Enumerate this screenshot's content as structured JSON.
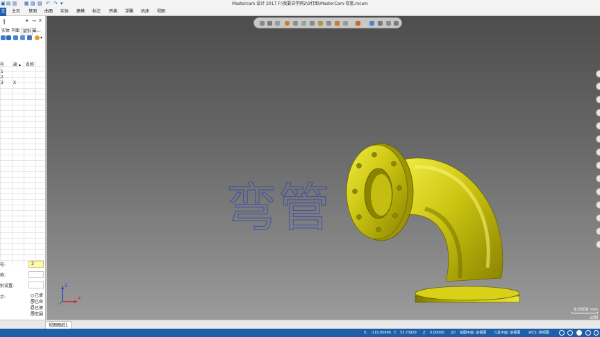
{
  "window": {
    "title": "Mastercam 设计 2017  F:\\我要自学网2\\9打图\\MasterCam-弯管.mcam"
  },
  "ribbon": {
    "file_tab": "文",
    "tabs": [
      "主页",
      "草图",
      "曲面",
      "实体",
      "建模",
      "标注",
      "转换",
      "浮雕",
      "机床",
      "视图"
    ]
  },
  "left_panel": {
    "title": "刂",
    "tabs": [
      "实体",
      "平面",
      "层别",
      "最..."
    ],
    "columns": [
      "号",
      "高",
      "名称"
    ],
    "rows": [
      {
        "num": "1",
        "flag": ""
      },
      {
        "num": "2",
        "flag": ""
      },
      {
        "num": "3",
        "flag": "X"
      }
    ],
    "fields": [
      {
        "label": "号:",
        "value": "3"
      },
      {
        "label": "称:",
        "value": ""
      },
      {
        "label": "别设置:",
        "value": ""
      }
    ],
    "display_label": "示:",
    "radio_options": [
      "已使用",
      "已命名",
      "已使用",
      "范围"
    ]
  },
  "viewport": {
    "model_label": "弯管",
    "scale_value": "9.0008 mm",
    "scale_unit": "公制",
    "axis_z": "Z",
    "axis_x": "X"
  },
  "sheet_tab": "视图图纸1",
  "status": {
    "x_label": "X:",
    "x_value": "-119.95986",
    "y_label": "Y:",
    "y_value": "53.73929",
    "z_label": "Z:",
    "z_value": "0.00000",
    "mode": "2D",
    "plane": "绘图平面: 前视图",
    "tool_plane": "刀具平面: 前视图",
    "wcs": "WCS: 俯视图"
  },
  "colors": {
    "ribbon_blue": "#1f5fa8",
    "pipe_yellow": "#d8d20a",
    "label_blue": "#3a4fa8"
  }
}
